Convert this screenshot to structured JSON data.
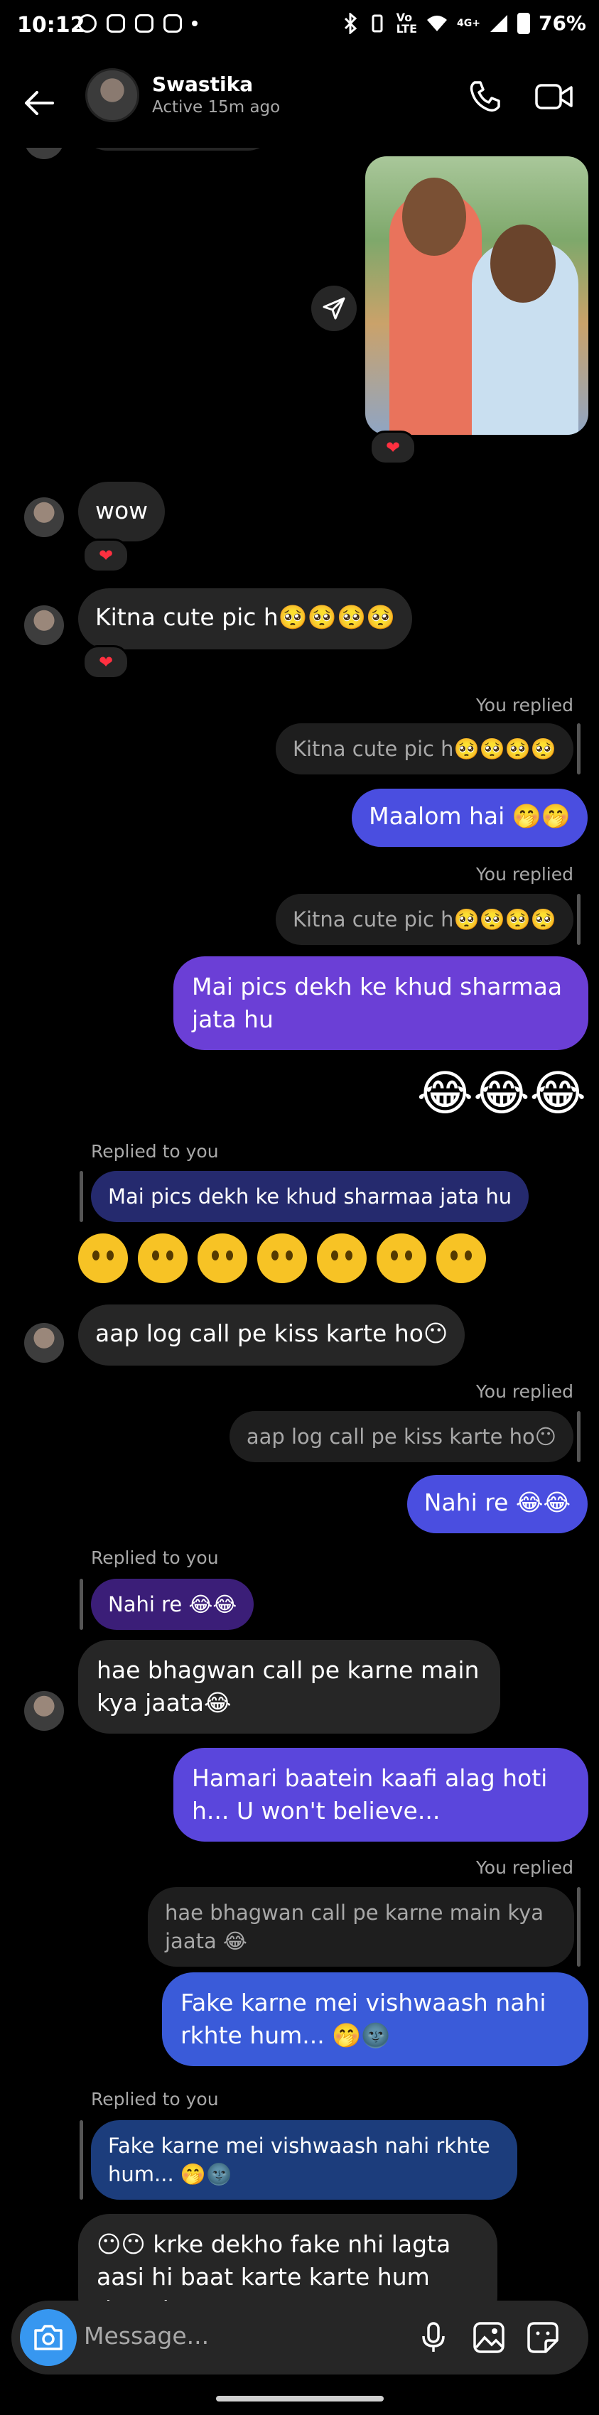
{
  "status_bar": {
    "time": "10:12",
    "battery": "76%",
    "network": "4G+"
  },
  "header": {
    "name": "Swastika",
    "status": "Active 15m ago"
  },
  "reaction": "❤",
  "messages": {
    "wow": "wow",
    "cute": "Kitna cute pic h🥺🥺🥺🥺",
    "you_replied_1": "You replied",
    "quote1": "Kitna cute pic h🥺🥺🥺🥺",
    "maalom": "Maalom hai 🤭🤭",
    "you_replied_2": "You replied",
    "quote2": "Kitna cute pic h🥺🥺🥺🥺",
    "sharmaa": "Mai pics dekh ke khud sharmaa jata hu",
    "laugh": "😂😂😂",
    "replied_to_you_1": "Replied to you",
    "quote3": "Mai pics dekh ke khud sharmaa jata hu",
    "neutral_faces": "😶😶😶😶😶😶😶",
    "kiss": "aap log call pe kiss karte ho😶",
    "you_replied_3": "You replied",
    "quote4": "aap log call pe kiss karte ho😶",
    "nahi": "Nahi re 😂😂",
    "replied_to_you_2": "Replied to you",
    "quote5": "Nahi re 😂😂",
    "bhagwan": "hae bhagwan call pe karne main kya jaata😂",
    "baatein": "Hamari baatein kaafi alag hoti h... U won't believe...",
    "you_replied_4": "You replied",
    "quote6": "hae bhagwan call pe karne main kya jaata 😂",
    "fake": "Fake karne mei vishwaash nahi rkhte hum... 🤭🌚",
    "replied_to_you_3": "Replied to you",
    "quote7": "Fake karne mei vishwaash nahi rkhte hum... 🤭🌚",
    "last": "😶😶 krke dekho fake nhi lagta aasi hi baat karte karte hum dono ko"
  },
  "composer": {
    "placeholder": "Message..."
  }
}
